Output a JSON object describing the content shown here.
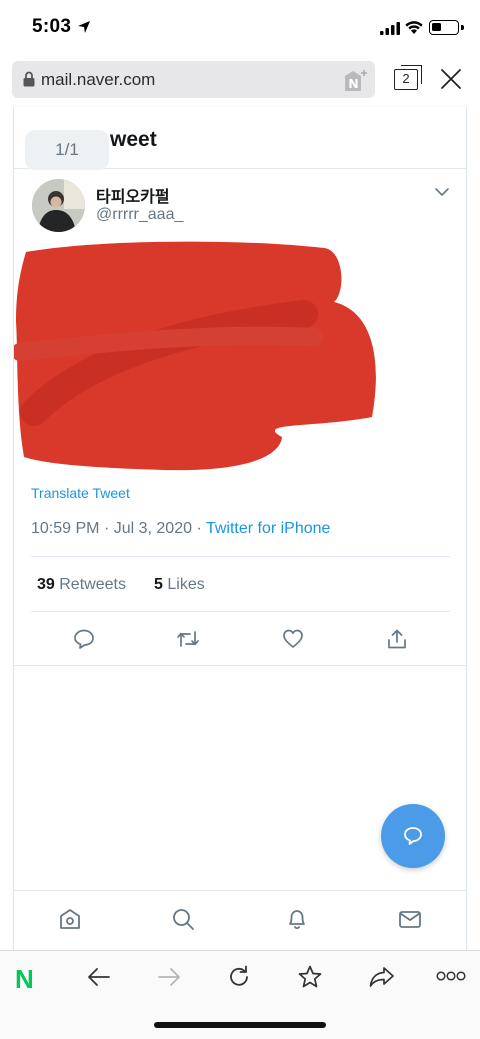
{
  "status_bar": {
    "time": "5:03"
  },
  "browser": {
    "url": "mail.naver.com",
    "tab_count": "2"
  },
  "tweet_page": {
    "header_title": "weet",
    "page_indicator": "1/1",
    "author": {
      "display_name": "타피오카펄",
      "handle": "@rrrrr_aaa_"
    },
    "translate_label": "Translate Tweet",
    "time": "10:59 PM",
    "separator": "·",
    "date": "Jul 3, 2020",
    "source": "Twitter for iPhone",
    "retweets_count": "39",
    "retweets_label": "Retweets",
    "likes_count": "5",
    "likes_label": "Likes",
    "redaction_color": "#d9392b"
  },
  "colors": {
    "twitter_blue": "#1b95e0",
    "fab": "#4b9be8",
    "naver_green": "#03c75a"
  },
  "toolbar": {
    "naver_logo": "N"
  }
}
